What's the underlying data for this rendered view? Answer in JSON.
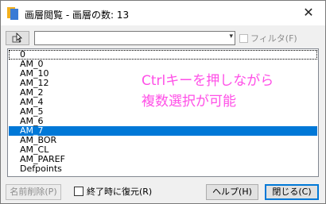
{
  "window": {
    "title": "画層閲覧 - 画層の数: 13",
    "close_glyph": "✕"
  },
  "toolbar": {
    "pick_icon": "select-object-icon",
    "combo_value": "",
    "combo_arrow": "▾",
    "filter_label": "フィルタ(F)",
    "filter_checked": false
  },
  "layers": [
    {
      "name": "0",
      "selected": false
    },
    {
      "name": "AM_0",
      "selected": false
    },
    {
      "name": "AM_10",
      "selected": false
    },
    {
      "name": "AM_12",
      "selected": false
    },
    {
      "name": "AM_2",
      "selected": false
    },
    {
      "name": "AM_4",
      "selected": false
    },
    {
      "name": "AM_5",
      "selected": false
    },
    {
      "name": "AM_6",
      "selected": false
    },
    {
      "name": "AM_7",
      "selected": true
    },
    {
      "name": "AM_BOR",
      "selected": false
    },
    {
      "name": "AM_CL",
      "selected": false
    },
    {
      "name": "AM_PAREF",
      "selected": false
    },
    {
      "name": "Defpoints",
      "selected": false
    }
  ],
  "annotation": {
    "line1": "Ctrlキーを押しながら",
    "line2": "複数選択が可能",
    "color": "#ff4fe7"
  },
  "footer": {
    "purge_label": "名前削除(P)",
    "restore_label": "終了時に復元(R)",
    "restore_checked": false,
    "help_label": "ヘルプ(H)",
    "close_label": "閉じる(C)"
  }
}
